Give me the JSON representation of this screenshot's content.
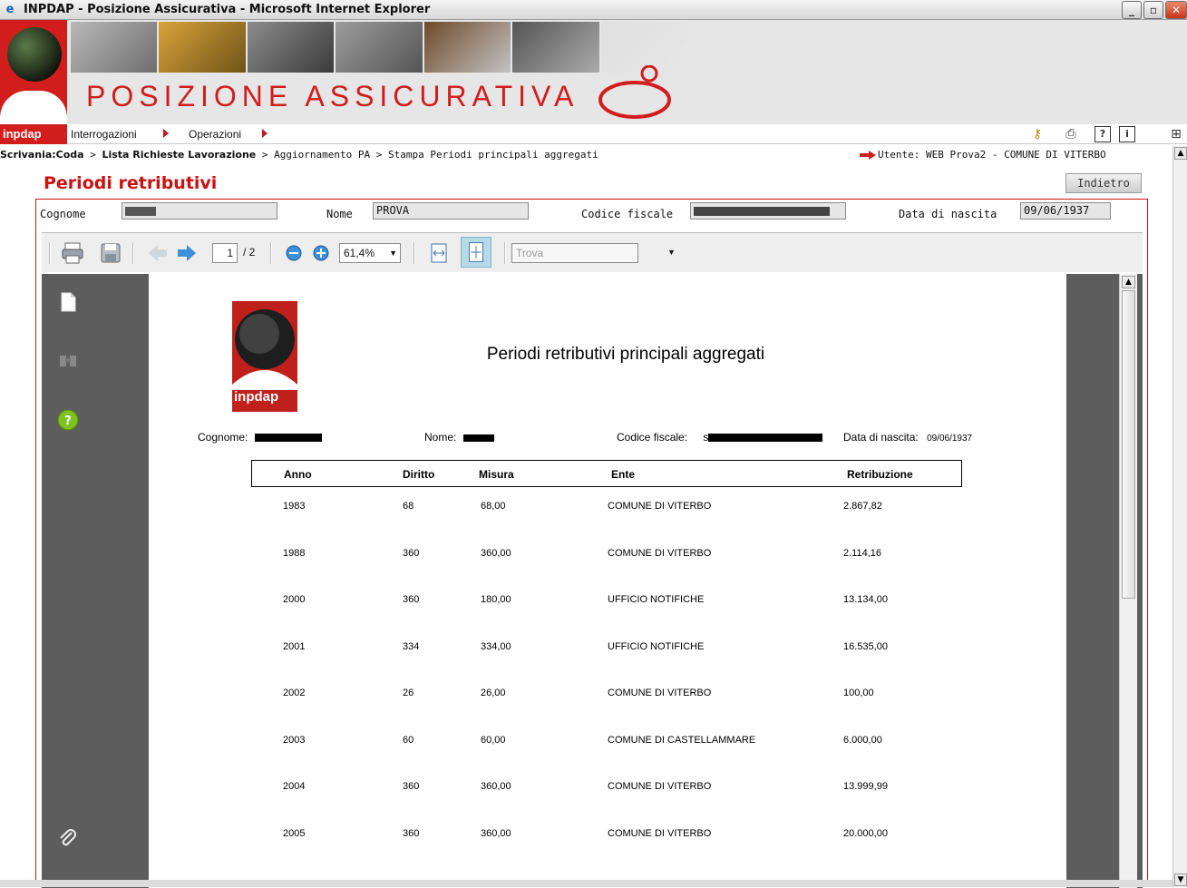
{
  "window": {
    "title": "INPDAP - Posizione Assicurativa - Microsoft Internet Explorer",
    "minimize_label": "_",
    "restore_label": "▫",
    "close_label": "✕"
  },
  "banner": {
    "title": "Posizione Assicurativa",
    "brand_color": "#d21d1d"
  },
  "menubar": {
    "logo_text": "inpdap",
    "items": [
      {
        "label": "Interrogazioni"
      },
      {
        "label": "Operazioni"
      }
    ],
    "tools": [
      "key-icon",
      "printer-icon",
      "help-icon",
      "info-icon",
      "sitemap-icon"
    ],
    "help_glyph": "?",
    "info_glyph": "i"
  },
  "breadcrumb": {
    "item1": "Scrivania:Coda",
    "sep": " > ",
    "item2": "Lista Richieste Lavorazione",
    "item3": "Aggiornamento PA",
    "item4": "Stampa Periodi principali aggregati",
    "user": "Utente: WEB Prova2 - COMUNE DI VITERBO"
  },
  "page": {
    "title": "Periodi retributivi",
    "back_label": "Indietro"
  },
  "fields": {
    "cognome_label": "Cognome",
    "nome_label": "Nome",
    "nome_value": "PROVA",
    "codice_fiscale_label": "Codice fiscale",
    "data_nascita_label": "Data di nascita",
    "data_nascita_value": "09/06/1937"
  },
  "viewer": {
    "page_current": "1",
    "page_total": "/ 2",
    "zoom": "61,4%",
    "search_placeholder": "Trova"
  },
  "document": {
    "logo_text": "inpdap",
    "title": "Periodi retributivi principali aggregati",
    "cognome_label": "Cognome:",
    "nome_label": "Nome:",
    "codice_fiscale_label": "Codice fiscale:",
    "codice_fiscale_prefix": "s",
    "data_nascita_label": "Data di nascita:",
    "data_nascita_value": "09/06/1937",
    "columns": [
      "Anno",
      "Diritto",
      "Misura",
      "Ente",
      "Retribuzione"
    ],
    "rows": [
      [
        "1983",
        "68",
        "68,00",
        "COMUNE DI VITERBO",
        "2.867,82"
      ],
      [
        "1988",
        "360",
        "360,00",
        "COMUNE DI VITERBO",
        "2.114,16"
      ],
      [
        "2000",
        "360",
        "180,00",
        "UFFICIO NOTIFICHE",
        "13.134,00"
      ],
      [
        "2001",
        "334",
        "334,00",
        "UFFICIO NOTIFICHE",
        "16.535,00"
      ],
      [
        "2002",
        "26",
        "26,00",
        "COMUNE DI VITERBO",
        "100,00"
      ],
      [
        "2003",
        "60",
        "60,00",
        "COMUNE DI CASTELLAMMARE",
        "6.000,00"
      ],
      [
        "2004",
        "360",
        "360,00",
        "COMUNE DI VITERBO",
        "13.999,99"
      ],
      [
        "2005",
        "360",
        "360,00",
        "COMUNE DI VITERBO",
        "20.000,00"
      ]
    ]
  }
}
